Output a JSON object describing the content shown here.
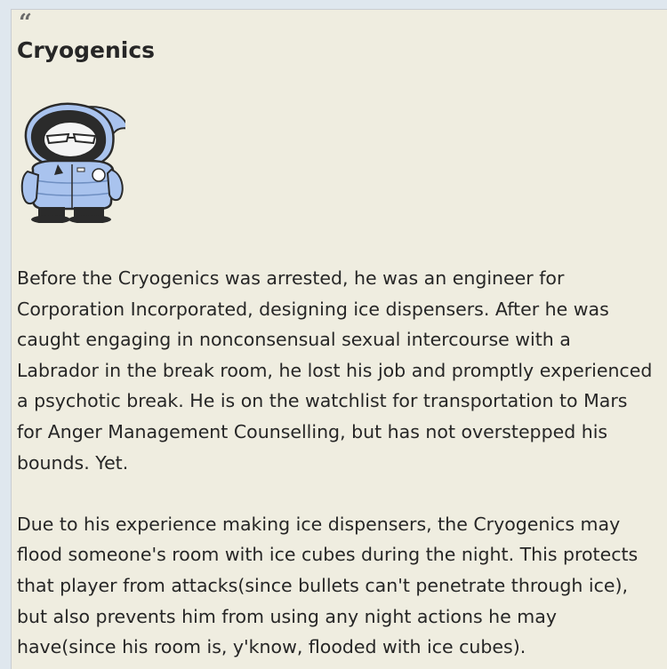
{
  "post": {
    "quote_mark": "“",
    "title": "Cryogenics",
    "avatar_icon": "cryogenics-character-icon",
    "paragraphs": [
      "Before the Cryogenics was arrested, he was an engineer for Corporation Incorporated, designing ice dispensers. After he was caught engaging in nonconsensual sexual intercourse with a Labrador in the break room, he lost his job and promptly experienced a psychotic break. He is on the watchlist for transportation to Mars for Anger Management Counselling, but has not overstepped his bounds. Yet.",
      "Due to his experience making ice dispensers, the Cryogenics may flood someone's room with ice cubes during the night. This protects that player from attacks(since bullets can't penetrate through ice), but also prevents him from using any night actions he may have(since his room is, y'know, flooded with ice cubes)."
    ]
  },
  "colors": {
    "page_background": "#dfe7ee",
    "card_background": "#efede0",
    "text": "#262626",
    "jacket": "#a9c3ee"
  }
}
